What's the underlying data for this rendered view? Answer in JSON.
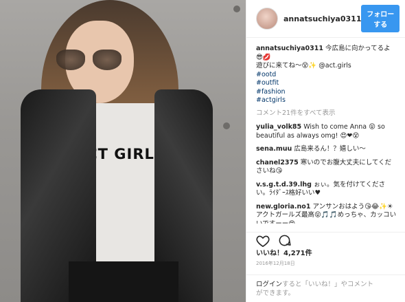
{
  "photo": {
    "shirt_text": "ACT GIRLS"
  },
  "header": {
    "username": "annatsuchiya0311",
    "follow_label": "フォローする"
  },
  "caption": {
    "username": "annatsuchiya0311",
    "text": "今広島に向かってるよ😎💋",
    "line2": "遊びに来てね〜😵✨ @act.girls",
    "hashtags": [
      "#ootd",
      "#outfit",
      "#fashion",
      "#actgirls"
    ]
  },
  "view_all_comments": "コメント21件をすべて表示",
  "comments": [
    {
      "username": "yulia_volk85",
      "text": "Wish to come Anna 😝 so beautiful as always omg! 😍❤😵"
    },
    {
      "username": "sena.muu",
      "text": "広島来るん！？嬉しい〜"
    },
    {
      "username": "chanel2375",
      "text": "寒いのでお腹大丈夫にしてくださいね😘"
    },
    {
      "username": "v.s.g.t.d.39.lhg",
      "text": "ぉぃ。気を付けてください。ﾗｲﾀﾞｰｽ格好いい♥"
    },
    {
      "username": "new.gloria.no1",
      "text": "アンサンおはよう😘😂✨☀アクトガールズ最高😝🎵🎵めっちゃ、カッコいいですーー😍"
    }
  ],
  "likes": "いいね！4,271件",
  "date": "2016年12月18日",
  "login": {
    "link": "ログイン",
    "text1": "すると「いいね！」やコメント",
    "text2": "ができます。"
  }
}
